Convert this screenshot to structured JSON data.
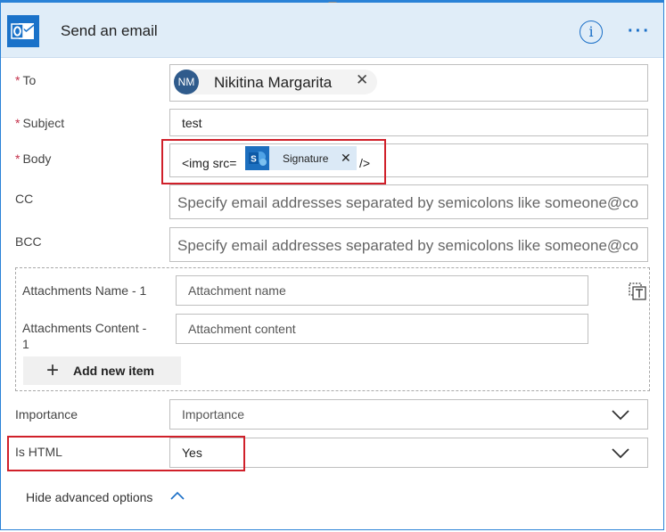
{
  "header": {
    "title": "Send an email",
    "info_icon": "i",
    "more_icon": "···"
  },
  "to": {
    "label": "To",
    "required_mark": "*",
    "avatar_initials": "NM",
    "person_name": "Nikitina Margarita",
    "remove_glyph": "✕"
  },
  "subject": {
    "label": "Subject",
    "required_mark": "*",
    "value": "test"
  },
  "body": {
    "label": "Body",
    "required_mark": "*",
    "prefix": "<img src=",
    "token_label": "Signature",
    "token_remove": "✕",
    "suffix": "/>"
  },
  "cc": {
    "label": "CC",
    "placeholder": "Specify email addresses separated by semicolons like someone@co"
  },
  "bcc": {
    "label": "BCC",
    "placeholder": "Specify email addresses separated by semicolons like someone@co"
  },
  "attachments": {
    "name_label": "Attachments Name - 1",
    "name_placeholder": "Attachment name",
    "content_label_line1": "Attachments Content -",
    "content_label_line2": "1",
    "content_placeholder": "Attachment content",
    "add_item_label": "Add new item",
    "add_glyph": "+"
  },
  "importance": {
    "label": "Importance",
    "value": "Importance"
  },
  "is_html": {
    "label": "Is HTML",
    "value": "Yes"
  },
  "footer": {
    "hide_advanced": "Hide advanced options"
  },
  "colors": {
    "accent": "#1a6fc7",
    "header_bg": "#e0edf8",
    "required": "#c4314b",
    "highlight_box": "#d0202a"
  },
  "icons": [
    "outlook-icon",
    "info-icon",
    "more-icon",
    "sharepoint-icon",
    "delete-icon",
    "chevron-down-icon",
    "chevron-up-icon"
  ]
}
